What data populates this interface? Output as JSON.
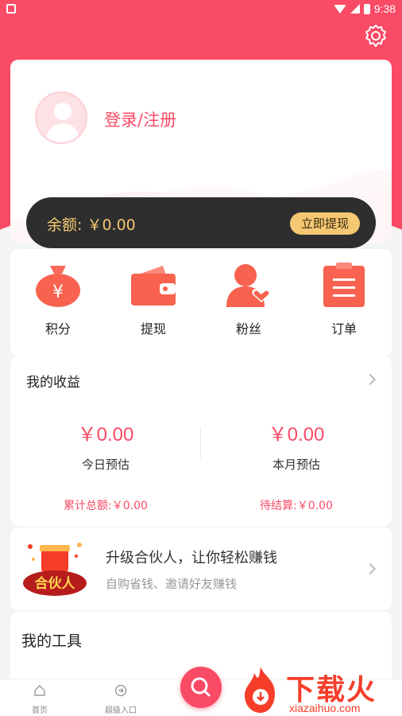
{
  "status_bar": {
    "time": "9:38"
  },
  "user": {
    "login_label": "登录/注册"
  },
  "balance": {
    "label": "余额: ￥0.00",
    "withdraw_button": "立即提现"
  },
  "menu": {
    "items": [
      {
        "label": "积分",
        "icon": "money-bag-icon"
      },
      {
        "label": "提现",
        "icon": "wallet-icon"
      },
      {
        "label": "粉丝",
        "icon": "fans-icon"
      },
      {
        "label": "订单",
        "icon": "order-icon"
      }
    ]
  },
  "earnings": {
    "title": "我的收益",
    "today_amount": "￥0.00",
    "today_label": "今日预估",
    "month_amount": "￥0.00",
    "month_label": "本月预估",
    "total_label": "累计总额:￥0.00",
    "pending_label": "待结算:￥0.00"
  },
  "partner": {
    "title": "升级合伙人，让你轻松赚钱",
    "subtitle": "自购省钱、邀请好友赚钱",
    "logo_text": "合伙人"
  },
  "tools": {
    "title": "我的工具"
  },
  "tabbar": {
    "tabs": [
      {
        "label": "首页"
      },
      {
        "label": "超级入口"
      }
    ]
  },
  "watermark": {
    "text": "下载火",
    "sub": "xiazaihuo.com"
  },
  "colors": {
    "primary": "#f94a66",
    "gold": "#f6c873",
    "dark": "#2e2e2e"
  }
}
